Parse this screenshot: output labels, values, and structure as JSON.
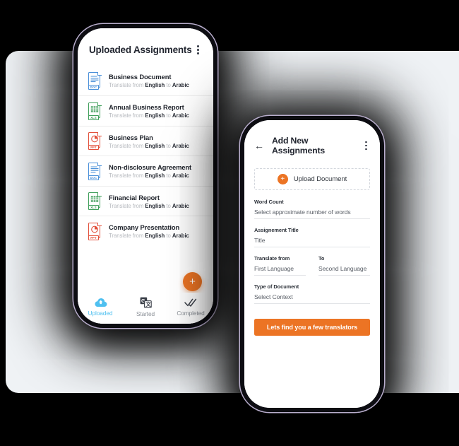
{
  "theme": {
    "accent": "#ec7424",
    "active_tab": "#4fc0f0",
    "card_bg": "#eff2f5",
    "page_bg": "#000000"
  },
  "left_phone": {
    "header": {
      "title": "Uploaded Assignments",
      "menu_icon": "kebab-menu-icon"
    },
    "assignments": [
      {
        "name": "Business Document",
        "prefix": "Translate from",
        "from": "English",
        "mid": "to",
        "to": "Arabic",
        "type": "DOC",
        "icon": "doc-file-icon"
      },
      {
        "name": "Annual  Business Report",
        "prefix": "Translate from",
        "from": "English",
        "mid": "to",
        "to": "Arabic",
        "type": "XLS",
        "icon": "xls-file-icon"
      },
      {
        "name": "Business Plan",
        "prefix": "Translate from",
        "from": "English",
        "mid": "to",
        "to": "Arabic",
        "type": "PPT",
        "icon": "ppt-file-icon"
      },
      {
        "name": "Non-disclosure Agreement",
        "prefix": "Translate from",
        "from": "English",
        "mid": "to",
        "to": "Arabic",
        "type": "DOC",
        "icon": "doc-file-icon"
      },
      {
        "name": "Financial Report",
        "prefix": "Translate from",
        "from": "English",
        "mid": "to",
        "to": "Arabic",
        "type": "XLS",
        "icon": "xls-file-icon"
      },
      {
        "name": "Company Presentation",
        "prefix": "Translate from",
        "from": "English",
        "mid": "to",
        "to": "Arabic",
        "type": "PPT",
        "icon": "ppt-file-icon"
      }
    ],
    "fab": {
      "label": "+",
      "icon": "plus-icon"
    },
    "tabs": [
      {
        "label": "Uploaded",
        "icon": "cloud-upload-icon",
        "active": true
      },
      {
        "label": "Started",
        "icon": "translate-icon",
        "active": false
      },
      {
        "label": "Completed",
        "icon": "double-check-icon",
        "active": false
      }
    ]
  },
  "right_phone": {
    "header": {
      "back_icon": "back-arrow-icon",
      "title": "Add New Assignments",
      "menu_icon": "kebab-menu-icon"
    },
    "upload": {
      "label": "Upload Document",
      "icon": "plus-circle-icon"
    },
    "fields": [
      {
        "label": "Word Count",
        "value": "Select approximate number of words"
      },
      {
        "label": "Assignement Title",
        "value": "Title"
      },
      {
        "label": "Translate from",
        "value": "First Language"
      },
      {
        "label": "To",
        "value": "Second Language"
      },
      {
        "label": "Type of Document",
        "value": "Select Context"
      }
    ],
    "cta": {
      "label": "Lets find you a few translators"
    }
  }
}
